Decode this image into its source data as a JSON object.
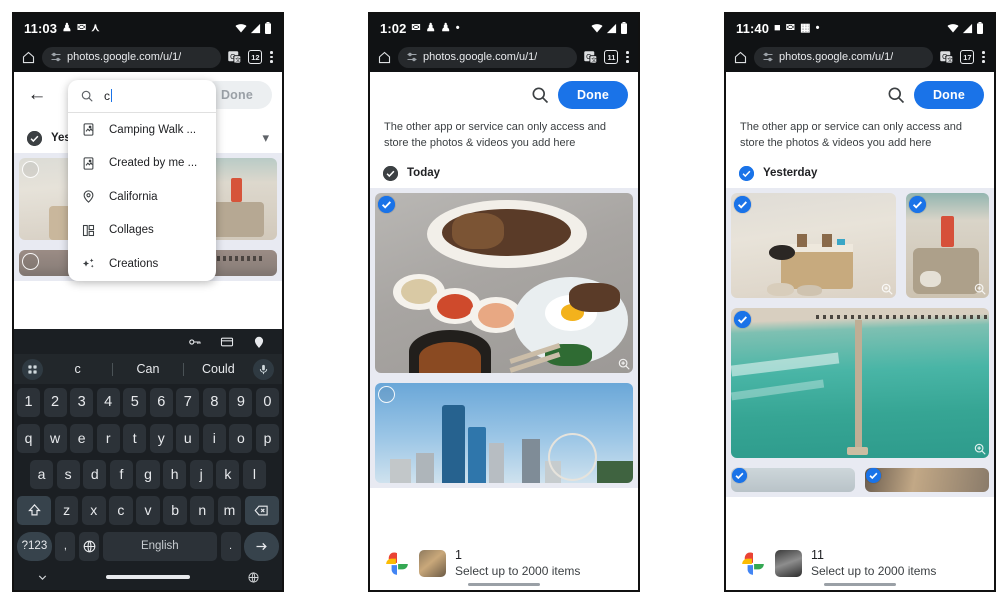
{
  "panels": [
    {
      "id": "panel-1",
      "status": {
        "time": "11:03",
        "icons": [
          "person-icon",
          "mail-icon",
          "antenna-icon"
        ],
        "right_icons": [
          "wifi-icon",
          "signal-icon",
          "battery-icon"
        ]
      },
      "browser": {
        "home_icon": "home-icon",
        "url": "photos.google.com/u/1/",
        "lock_icon": "tune-icon",
        "translate_icon": "translate-icon",
        "tab_count": "12",
        "menu_icon": "overflow-menu-icon"
      },
      "app": {
        "back_icon": "back-arrow-icon",
        "done_label": "Done",
        "done_disabled": true,
        "date_label": "Yesterday",
        "date_selected": false,
        "search": {
          "icon": "search-icon",
          "query": "c",
          "suggestions": [
            {
              "icon": "photo-album-icon",
              "label": "Camping Walk ..."
            },
            {
              "icon": "photo-album-icon",
              "label": "Created by me ..."
            },
            {
              "icon": "location-pin-icon",
              "label": "California"
            },
            {
              "icon": "collage-icon",
              "label": "Collages"
            },
            {
              "icon": "sparkle-icon",
              "label": "Creations"
            }
          ]
        }
      },
      "keyboard": {
        "toolbar_icons": [
          "key-icon",
          "card-icon",
          "location-pin-icon"
        ],
        "grid_icon": "app-grid-icon",
        "mic_icon": "microphone-icon",
        "suggestions": [
          "c",
          "Can",
          "Could"
        ],
        "rows": [
          [
            "1",
            "2",
            "3",
            "4",
            "5",
            "6",
            "7",
            "8",
            "9",
            "0"
          ],
          [
            "q",
            "w",
            "e",
            "r",
            "t",
            "y",
            "u",
            "i",
            "o",
            "p"
          ],
          [
            "a",
            "s",
            "d",
            "f",
            "g",
            "h",
            "j",
            "k",
            "l"
          ],
          [
            "z",
            "x",
            "c",
            "v",
            "b",
            "n",
            "m"
          ]
        ],
        "shift_icon": "shift-icon",
        "backspace_icon": "backspace-icon",
        "symbols_label": "?123",
        "comma_label": ",",
        "globe_icon": "globe-icon",
        "space_label": "English",
        "period_label": ".",
        "enter_icon": "enter-arrow-icon",
        "nav_back_icon": "chevron-down-icon",
        "nav_globe_icon": "globe-icon"
      }
    },
    {
      "id": "panel-2",
      "status": {
        "time": "1:02",
        "icons": [
          "mail-icon",
          "person-icon",
          "person-icon",
          "dot-icon"
        ],
        "right_icons": [
          "wifi-icon",
          "signal-icon",
          "battery-icon"
        ]
      },
      "browser": {
        "home_icon": "home-icon",
        "url": "photos.google.com/u/1/",
        "lock_icon": "tune-icon",
        "translate_icon": "translate-icon",
        "tab_count": "11",
        "menu_icon": "overflow-menu-icon"
      },
      "app": {
        "search_icon": "search-icon",
        "done_label": "Done",
        "done_disabled": false,
        "notice": "The other app or service can only access and store the photos & videos you add here",
        "date_label": "Today",
        "date_selected": false,
        "photos": [
          {
            "name": "korean-food-photo",
            "selected": true,
            "zoom_icon": "zoom-in-icon"
          },
          {
            "name": "city-skyline-photo",
            "selected": false,
            "zoom_icon": "zoom-in-icon"
          }
        ]
      },
      "bottombar": {
        "logo_icon": "google-photos-logo",
        "thumb": "korean-food-thumb",
        "count": "1",
        "subtitle": "Select up to 2000 items"
      }
    },
    {
      "id": "panel-3",
      "status": {
        "time": "11:40",
        "icons": [
          "chat-icon",
          "mail-icon",
          "calendar-icon",
          "dot-icon"
        ],
        "right_icons": [
          "wifi-icon",
          "signal-icon",
          "battery-icon"
        ]
      },
      "browser": {
        "home_icon": "home-icon",
        "url": "photos.google.com/u/1/",
        "lock_icon": "tune-icon",
        "translate_icon": "translate-icon",
        "tab_count": "17",
        "menu_icon": "overflow-menu-icon"
      },
      "app": {
        "search_icon": "search-icon",
        "done_label": "Done",
        "done_disabled": false,
        "notice": "The other app or service can only access and store the photos & videos you add here",
        "date_label": "Yesterday",
        "date_selected": true,
        "photos": [
          {
            "name": "beach-bag-photo",
            "selected": true,
            "zoom_icon": "zoom-in-icon"
          },
          {
            "name": "beach-towel-photo",
            "selected": true,
            "zoom_icon": "zoom-in-icon"
          },
          {
            "name": "aerial-pier-photo",
            "selected": true,
            "zoom_icon": "zoom-in-icon"
          },
          {
            "name": "partial-photo-left",
            "selected": true,
            "zoom_icon": ""
          },
          {
            "name": "partial-photo-right",
            "selected": true,
            "zoom_icon": ""
          }
        ]
      },
      "bottombar": {
        "logo_icon": "google-photos-logo",
        "thumb": "crowd-thumb",
        "count": "11",
        "subtitle": "Select up to 2000 items"
      }
    }
  ],
  "colors": {
    "accent_blue": "#1a73e8",
    "status_bg": "#101214",
    "tile_bg": "#e8eaf2",
    "keyboard_bg": "#1b1f23",
    "key_bg": "#2c3238",
    "text_primary": "#202124"
  }
}
